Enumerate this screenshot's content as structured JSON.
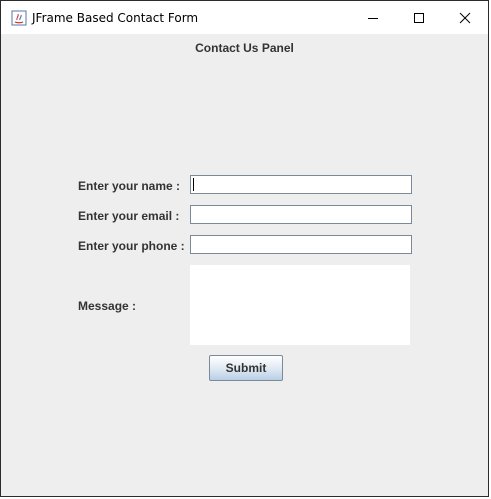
{
  "window": {
    "title": "JFrame Based Contact Form",
    "controls": {
      "minimize_icon": "minimize-icon",
      "maximize_icon": "maximize-icon",
      "close_icon": "close-icon"
    }
  },
  "panel": {
    "title": "Contact Us Panel"
  },
  "form": {
    "name_label": "Enter your name :",
    "name_value": "",
    "email_label": "Enter your email :",
    "email_value": "",
    "phone_label": "Enter your phone :",
    "phone_value": "",
    "message_label": "Message :",
    "message_value": "",
    "submit_label": "Submit"
  },
  "colors": {
    "panel_background": "#eeeeee",
    "titlebar_background": "#ffffff",
    "label_text": "#333333",
    "field_border": "#7a8a99"
  }
}
